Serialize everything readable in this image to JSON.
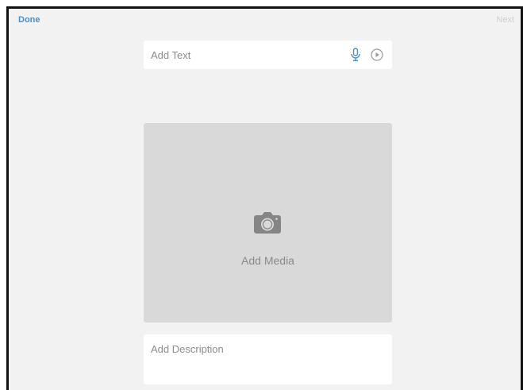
{
  "nav": {
    "done_label": "Done",
    "next_label": "Next"
  },
  "text_field": {
    "placeholder": "Add Text",
    "mic_icon": "microphone-icon",
    "play_icon": "play-circle-icon"
  },
  "media": {
    "label": "Add Media",
    "icon": "camera-icon"
  },
  "description_field": {
    "placeholder": "Add Description"
  },
  "colors": {
    "accent": "#4a90c8",
    "background": "#f2f2f2",
    "media_background": "#d9d9d9",
    "disabled_text": "#cfcfcf",
    "placeholder_text": "#8e8e8e"
  }
}
